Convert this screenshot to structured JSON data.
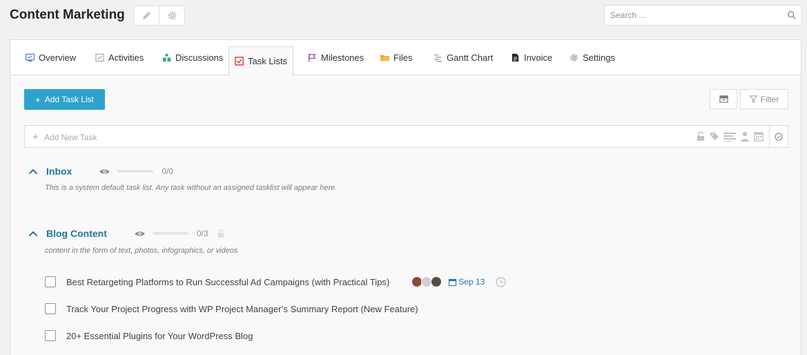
{
  "header": {
    "title": "Content Marketing",
    "search_placeholder": "Search ..."
  },
  "tabs": [
    {
      "label": "Overview",
      "icon": "overview-icon"
    },
    {
      "label": "Activities",
      "icon": "activities-icon"
    },
    {
      "label": "Discussions",
      "icon": "discussions-icon"
    },
    {
      "label": "Task Lists",
      "icon": "task-lists-icon",
      "active": true
    },
    {
      "label": "Milestones",
      "icon": "milestones-icon"
    },
    {
      "label": "Files",
      "icon": "folder-icon"
    },
    {
      "label": "Gantt Chart",
      "icon": "gantt-icon"
    },
    {
      "label": "Invoice",
      "icon": "invoice-icon"
    },
    {
      "label": "Settings",
      "icon": "gear-icon"
    }
  ],
  "toolbar": {
    "add_task_list": "Add Task List",
    "filter": "Filter"
  },
  "new_task": {
    "placeholder": "Add New Task"
  },
  "lists": [
    {
      "title": "Inbox",
      "progress": "0/0",
      "progress_fraction": 0,
      "description": "This is a system default task list. Any task without an assigned tasklist will appear here."
    },
    {
      "title": "Blog Content",
      "progress": "0/3",
      "progress_fraction": 0,
      "description": "content in the form of text, photos, infographics, or videos",
      "tasks": [
        {
          "text": "Best Retargeting Platforms to Run Successful Ad Campaigns (with Practical Tips)",
          "due": "Sep 13"
        },
        {
          "text": "Track Your Project Progress with WP Project Manager’s Summary Report (New Feature)"
        },
        {
          "text": "20+ Essential Plugins for Your WordPress Blog"
        }
      ]
    }
  ],
  "colors": {
    "accent": "#2ea2cc",
    "link": "#21759b",
    "task_lists_icon": "#d63638",
    "milestones_icon": "#8e44ad",
    "files_icon": "#f0a030",
    "discussions_icon": "#3aa57a"
  }
}
